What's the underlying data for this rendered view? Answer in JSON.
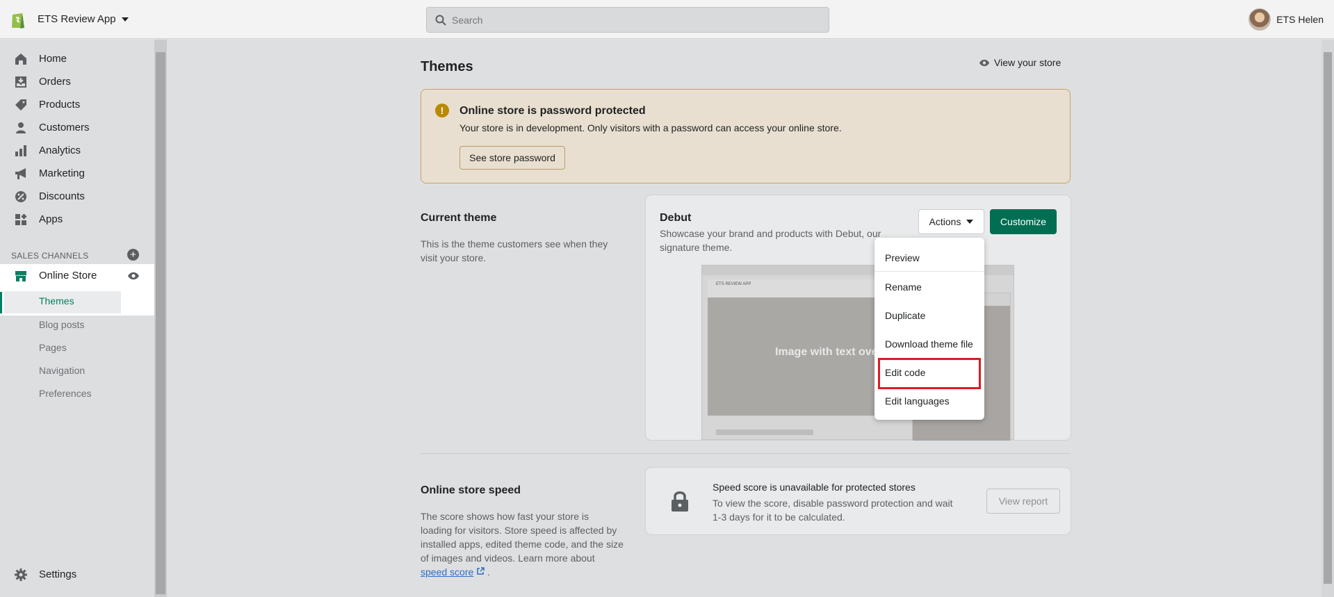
{
  "topbar": {
    "store_name": "ETS Review App",
    "search_placeholder": "Search",
    "user_name": "ETS Helen"
  },
  "sidebar": {
    "items": [
      {
        "label": "Home",
        "icon": "home-icon"
      },
      {
        "label": "Orders",
        "icon": "orders-icon"
      },
      {
        "label": "Products",
        "icon": "tag-icon"
      },
      {
        "label": "Customers",
        "icon": "person-icon"
      },
      {
        "label": "Analytics",
        "icon": "bar-chart-icon"
      },
      {
        "label": "Marketing",
        "icon": "megaphone-icon"
      },
      {
        "label": "Discounts",
        "icon": "discount-icon"
      },
      {
        "label": "Apps",
        "icon": "apps-icon"
      }
    ],
    "sales_channels_label": "SALES CHANNELS",
    "online_store": "Online Store",
    "sub_items": [
      "Themes",
      "Blog posts",
      "Pages",
      "Navigation",
      "Preferences"
    ],
    "settings": "Settings"
  },
  "main": {
    "title": "Themes",
    "view_store": "View your store",
    "banner": {
      "title": "Online store is password protected",
      "text": "Your store is in development. Only visitors with a password can access your online store.",
      "button": "See store password"
    },
    "current_theme": {
      "heading": "Current theme",
      "desc_line1": "This is the theme customers see when they",
      "desc_line2": "visit your store.",
      "name": "Debut",
      "desc": "Showcase your brand and products with Debut, our signature theme.",
      "actions_label": "Actions",
      "customize_label": "Customize",
      "preview_header": "ETS REVIEW APP",
      "preview_hero": "Image with text overlay"
    },
    "actions_menu": [
      "Preview",
      "Rename",
      "Duplicate",
      "Download theme file",
      "Edit code",
      "Edit languages"
    ],
    "speed": {
      "heading": "Online store speed",
      "desc_lines": [
        "The score shows how fast your store is",
        "loading for visitors. Store speed is affected by",
        "installed apps, edited theme code, and the size",
        "of images and videos. Learn more about"
      ],
      "link": "speed score",
      "card_title": "Speed score is unavailable for protected stores",
      "card_text": "To view the score, disable password protection and wait 1-3 days for it to be calculated.",
      "card_button": "View report"
    }
  },
  "colors": {
    "primary": "#006e52",
    "highlight": "#e01b24",
    "warning": "#b98900"
  }
}
